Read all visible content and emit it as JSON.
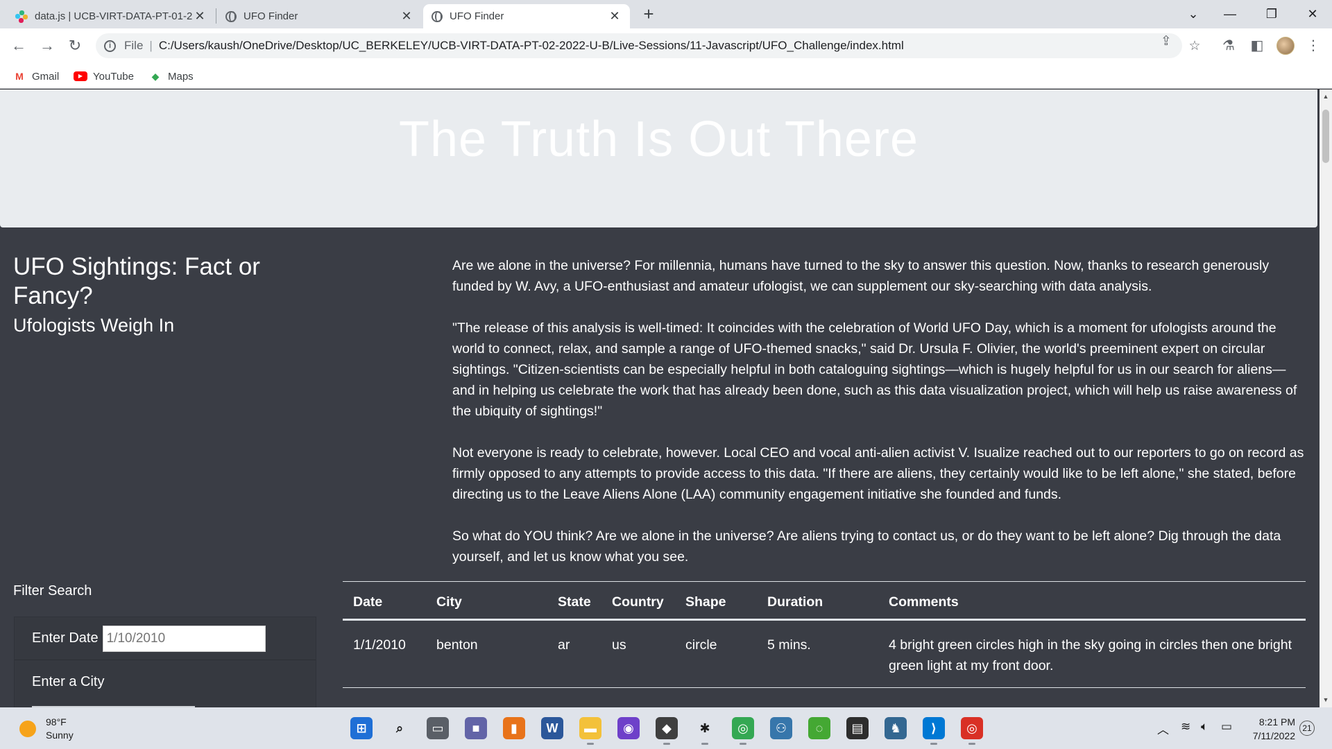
{
  "browser": {
    "tabs": [
      {
        "title": "data.js | UCB-VIRT-DATA-PT-01-2",
        "icon": "slack-icon",
        "active": false
      },
      {
        "title": "UFO Finder",
        "icon": "globe-icon",
        "active": false
      },
      {
        "title": "UFO Finder",
        "icon": "globe-icon",
        "active": true
      }
    ],
    "new_tab_label": "+",
    "window_controls": {
      "tab_search": "⌄",
      "minimize": "—",
      "restore": "❐",
      "close": "✕"
    },
    "address": {
      "scheme_label": "File",
      "url": "C:/Users/kaush/OneDrive/Desktop/UC_BERKELEY/UCB-VIRT-DATA-PT-02-2022-U-B/Live-Sessions/11-Javascript/UFO_Challenge/index.html"
    },
    "bookmarks": [
      {
        "label": "Gmail",
        "icon": "gmail-icon"
      },
      {
        "label": "YouTube",
        "icon": "youtube-icon"
      },
      {
        "label": "Maps",
        "icon": "maps-icon"
      }
    ]
  },
  "page": {
    "hero_title": "The Truth Is Out There",
    "heading": "UFO Sightings: Fact or Fancy?",
    "subheading": "Ufologists Weigh In",
    "article": [
      "Are we alone in the universe? For millennia, humans have turned to the sky to answer this question. Now, thanks to research generously funded by W. Avy, a UFO-enthusiast and amateur ufologist, we can supplement our sky-searching with data analysis.",
      "\"The release of this analysis is well-timed: It coincides with the celebration of World UFO Day, which is a moment for ufologists around the world to connect, relax, and sample a range of UFO-themed snacks,\" said Dr. Ursula F. Olivier, the world's preeminent expert on circular sightings. \"Citizen-scientists can be especially helpful in both cataloguing sightings—which is hugely helpful for us in our search for aliens—and in helping us celebrate the work that has already been done, such as this data visualization project, which will help us raise awareness of the ubiquity of sightings!\"",
      "Not everyone is ready to celebrate, however. Local CEO and vocal anti-alien activist V. Isualize reached out to our reporters to go on record as firmly opposed to any attempts to provide access to this data. \"If there are aliens, they certainly would like to be left alone,\" she stated, before directing us to the Leave Aliens Alone (LAA) community engagement initiative she founded and funds.",
      "So what do YOU think? Are we alone in the universe? Are aliens trying to contact us, or do they want to be left alone? Dig through the data yourself, and let us know what you see."
    ],
    "filter": {
      "title": "Filter Search",
      "date_label": "Enter Date",
      "date_placeholder": "1/10/2010",
      "city_label": "Enter a City"
    },
    "table": {
      "headers": [
        "Date",
        "City",
        "State",
        "Country",
        "Shape",
        "Duration",
        "Comments"
      ],
      "rows": [
        [
          "1/1/2010",
          "benton",
          "ar",
          "us",
          "circle",
          "5 mins.",
          "4 bright green circles high in the sky going in circles then one bright green light at my front door."
        ]
      ]
    }
  },
  "taskbar": {
    "weather_temp": "98°F",
    "weather_desc": "Sunny",
    "apps": [
      {
        "name": "windows-start-icon",
        "color": "#1f6fd6",
        "glyph": "⊞"
      },
      {
        "name": "search-icon",
        "color": "transparent",
        "glyph": "⌕"
      },
      {
        "name": "task-view-icon",
        "color": "#5a5f67",
        "glyph": "▭"
      },
      {
        "name": "teams-chat-icon",
        "color": "#6264a7",
        "glyph": "■"
      },
      {
        "name": "office-icon",
        "color": "#e8731a",
        "glyph": "▮"
      },
      {
        "name": "word-icon",
        "color": "#2b579a",
        "glyph": "W"
      },
      {
        "name": "file-explorer-icon",
        "color": "#f3c13a",
        "glyph": "▬"
      },
      {
        "name": "github-desktop-icon",
        "color": "#6e40c9",
        "glyph": "◉"
      },
      {
        "name": "git-icon",
        "color": "#3f3f3f",
        "glyph": "◆"
      },
      {
        "name": "slack-icon",
        "color": "#ffffff",
        "glyph": "✱"
      },
      {
        "name": "chrome-icon",
        "color": "#34a853",
        "glyph": "◎"
      },
      {
        "name": "python-icon",
        "color": "#3776ab",
        "glyph": "⚇"
      },
      {
        "name": "anaconda-icon",
        "color": "#44a833",
        "glyph": "◌"
      },
      {
        "name": "terminal-icon",
        "color": "#2d2d2d",
        "glyph": "▤"
      },
      {
        "name": "postgres-icon",
        "color": "#336791",
        "glyph": "♞"
      },
      {
        "name": "vscode-icon",
        "color": "#0078d4",
        "glyph": "⟩"
      },
      {
        "name": "chrome-dev-icon",
        "color": "#d93025",
        "glyph": "◎"
      }
    ],
    "clock_time": "8:21 PM",
    "clock_date": "7/11/2022",
    "notifications": "21"
  }
}
